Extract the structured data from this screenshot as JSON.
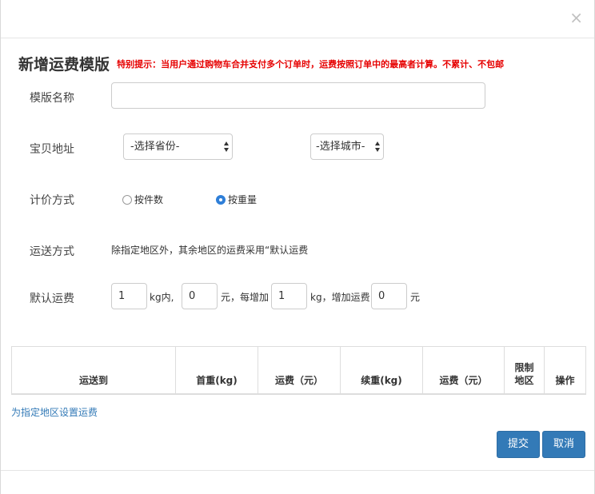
{
  "header": {
    "close_label": "×"
  },
  "title": "新增运费模版",
  "notice": "特别提示：当用户通过购物车合并支付多个订单时，运费按照订单中的最高者计算。不累计、不包邮",
  "form": {
    "template_name": {
      "label": "模版名称",
      "value": "",
      "placeholder": ""
    },
    "location": {
      "label": "宝贝地址",
      "province": "-选择省份-",
      "city": "-选择城市-"
    },
    "pricing": {
      "label": "计价方式",
      "options": [
        "按件数",
        "按重量"
      ],
      "selected": "按重量"
    },
    "shipping": {
      "label": "运送方式",
      "desc": "除指定地区外，其余地区的运费采用“默认运费"
    },
    "default_fee": {
      "label": "默认运费",
      "first_weight": "1",
      "unit_first": "kg内,",
      "first_fee": "0",
      "unit_fee": "元，每增加",
      "add_weight": "1",
      "unit_add": "kg，增加运费",
      "add_fee": "0",
      "unit_yuan": "元"
    }
  },
  "table": {
    "headers": [
      "运送到",
      "首重(kg)",
      "运费（元）",
      "续重(kg)",
      "运费（元）",
      "限制\n地区",
      "操作"
    ]
  },
  "link": "为指定地区设置运费",
  "buttons": {
    "submit": "提交",
    "cancel": "取消"
  },
  "colors": {
    "primary": "#337ab7",
    "notice": "#e60000",
    "radio_checked": "#2f7fd8"
  }
}
